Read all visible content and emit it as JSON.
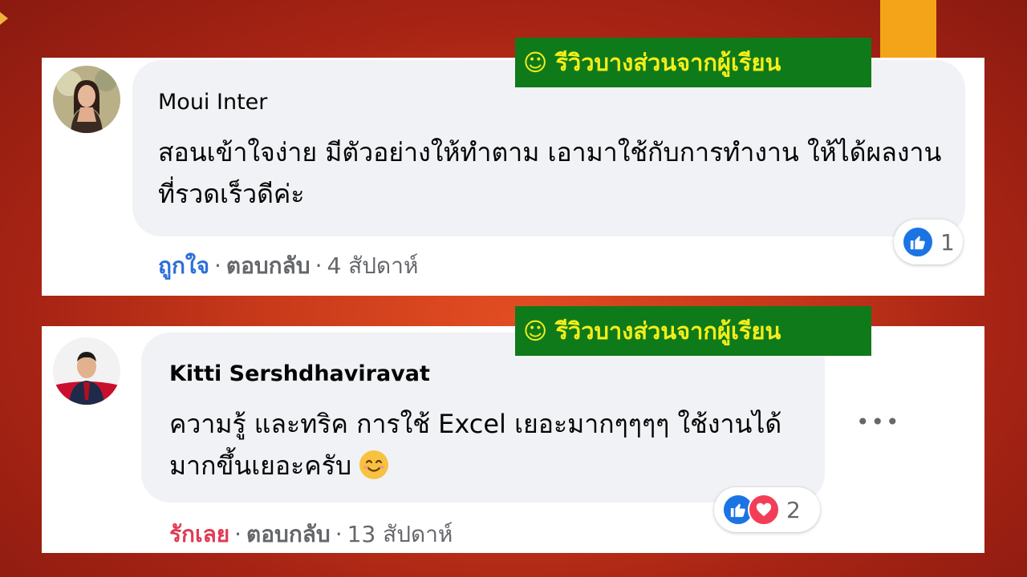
{
  "colors": {
    "background": "#c7391a",
    "accent_bar": "#f4a418",
    "label_bg": "#0f7a1a",
    "label_text": "#f4ee1a",
    "like_blue": "#2d6fdb",
    "love_red": "#e03b53"
  },
  "comments": [
    {
      "label": "☺ รีวิวบางส่วนจากผู้เรียน",
      "author": "Moui Inter",
      "text": "สอนเข้าใจง่าย มีตัวอย่างให้ทำตาม เอามาใช้กับการทำงาน ให้ได้ผลงานที่รวดเร็วดีค่ะ",
      "reaction_label": "ถูกใจ",
      "reply_label": "ตอบกลับ",
      "time": "4 สัปดาห์",
      "reaction_icons": [
        "like-icon"
      ],
      "reaction_count": "1",
      "separator": "·"
    },
    {
      "label": "☺ รีวิวบางส่วนจากผู้เรียน",
      "author": "Kitti Sershdhaviravat",
      "text": "ความรู้ และทริค การใช้ Excel เยอะมากๆๆๆๆ ใช้งานได้มากขึ้นเยอะครับ",
      "emoji": "smiling-face-emoji",
      "reaction_label": "รักเลย",
      "reply_label": "ตอบกลับ",
      "time": "13 สัปดาห์",
      "reaction_icons": [
        "like-icon",
        "love-icon"
      ],
      "reaction_count": "2",
      "separator": "·",
      "more_label": "•••"
    }
  ]
}
